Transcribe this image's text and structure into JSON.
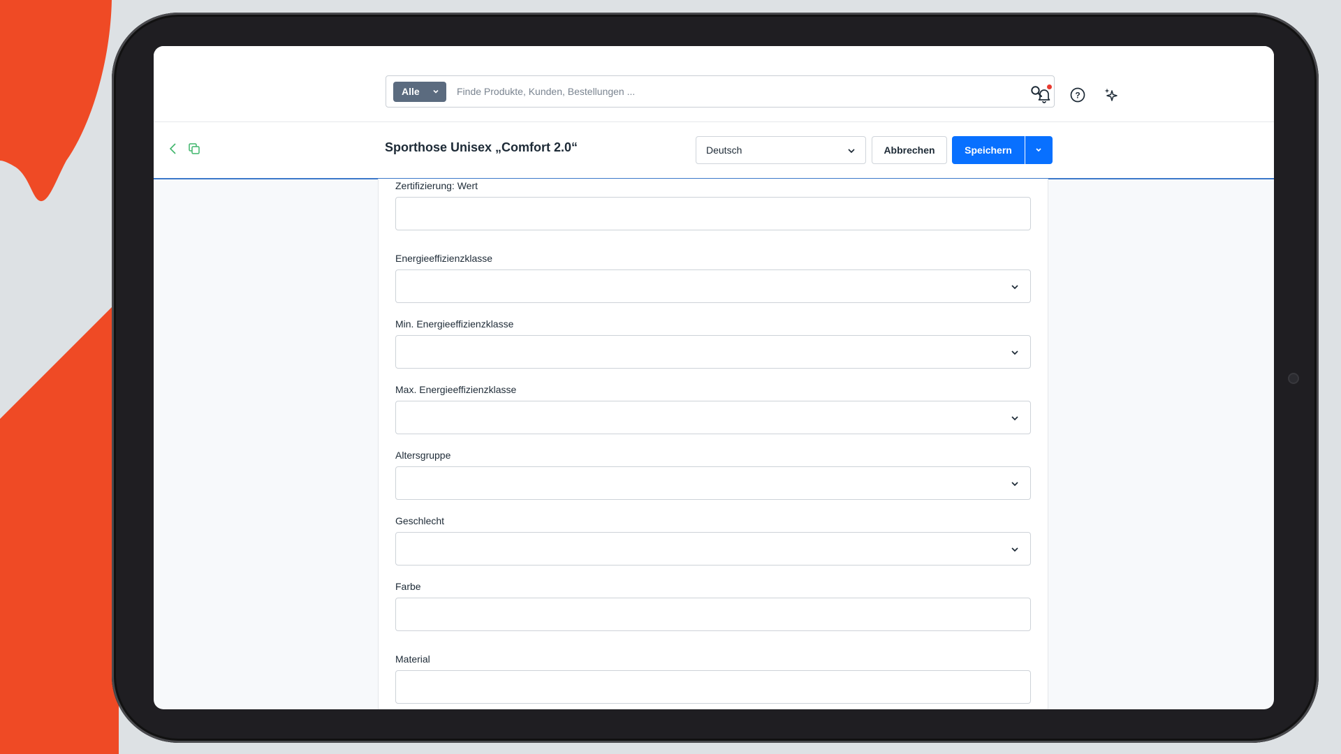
{
  "colors": {
    "accent": "#0870ff",
    "brand_orange": "#ef4a25",
    "scope_button": "#5b6b7f",
    "notification_dot": "#e8392f"
  },
  "search": {
    "scope_label": "Alle",
    "placeholder": "Finde Produkte, Kunden, Bestellungen ...",
    "icon": "search-icon"
  },
  "top_icons": [
    "bell-icon",
    "help-icon",
    "sparkle-icon"
  ],
  "header": {
    "title": "Sporthose Unisex „Comfort 2.0“",
    "language": "Deutsch",
    "cancel_label": "Abbrechen",
    "save_label": "Speichern"
  },
  "form": {
    "fields": [
      {
        "label": "Zertifizierung: Wert",
        "type": "text",
        "value": ""
      },
      {
        "label": "Energieeffizienzklasse",
        "type": "select",
        "value": ""
      },
      {
        "label": "Min. Energieeffizienzklasse",
        "type": "select",
        "value": ""
      },
      {
        "label": "Max. Energieeffizienzklasse",
        "type": "select",
        "value": ""
      },
      {
        "label": "Altersgruppe",
        "type": "select",
        "value": ""
      },
      {
        "label": "Geschlecht",
        "type": "select",
        "value": ""
      },
      {
        "label": "Farbe",
        "type": "text",
        "value": ""
      },
      {
        "label": "Material",
        "type": "text",
        "value": ""
      }
    ]
  }
}
